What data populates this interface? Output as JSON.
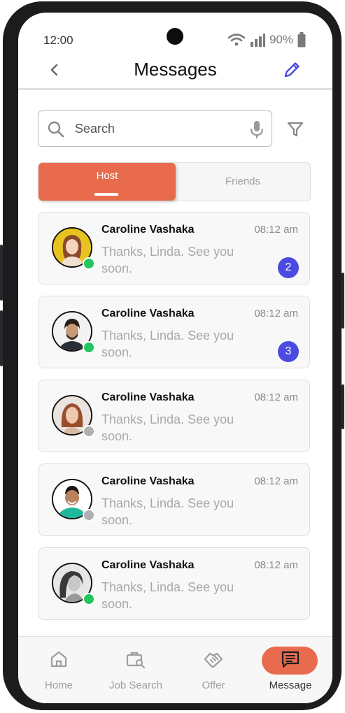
{
  "status": {
    "time": "12:00",
    "battery": "90%"
  },
  "header": {
    "title": "Messages"
  },
  "search": {
    "placeholder": "Search"
  },
  "tabs": [
    {
      "label": "Host",
      "active": true
    },
    {
      "label": "Friends",
      "active": false
    }
  ],
  "messages": [
    {
      "name": "Caroline Vashaka",
      "time": "08:12 am",
      "preview": "Thanks, Linda. See you soon.",
      "unread": "2",
      "online": true
    },
    {
      "name": "Caroline Vashaka",
      "time": "08:12 am",
      "preview": "Thanks, Linda. See you soon.",
      "unread": "3",
      "online": true
    },
    {
      "name": "Caroline Vashaka",
      "time": "08:12 am",
      "preview": "Thanks, Linda. See you soon.",
      "unread": "",
      "online": false
    },
    {
      "name": "Caroline Vashaka",
      "time": "08:12 am",
      "preview": "Thanks, Linda. See you soon.",
      "unread": "",
      "online": false
    },
    {
      "name": "Caroline Vashaka",
      "time": "08:12 am",
      "preview": "Thanks, Linda. See you soon.",
      "unread": "",
      "online": true
    }
  ],
  "nav": [
    {
      "label": "Home",
      "icon": "home-icon"
    },
    {
      "label": "Job Search",
      "icon": "job-search-icon"
    },
    {
      "label": "Offer",
      "icon": "handshake-icon"
    },
    {
      "label": "Message",
      "icon": "message-icon",
      "active": true
    }
  ],
  "colors": {
    "accent": "#e86b4e",
    "badge": "#4b4be0",
    "online": "#22c55e",
    "offline": "#b0b0b0",
    "edit": "#4b4be0"
  }
}
